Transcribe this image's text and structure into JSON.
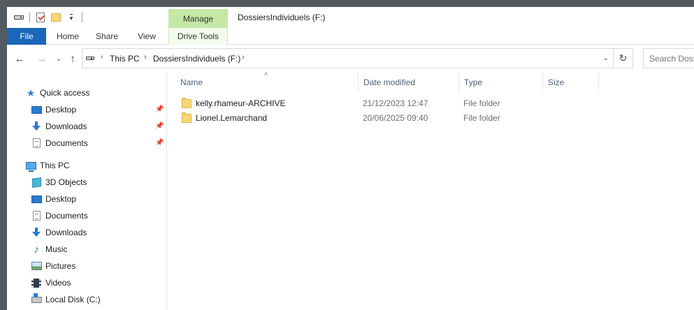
{
  "title_bar": {
    "manage_tab": "Manage",
    "window_title": "DossiersIndividuels (F:)"
  },
  "ribbon": {
    "tabs": [
      "File",
      "Home",
      "Share",
      "View",
      "Drive Tools"
    ]
  },
  "address": {
    "crumbs": [
      "This PC",
      "DossiersIndividuels (F:)"
    ],
    "search_placeholder": "Search Dossiers"
  },
  "nav_pane": {
    "quick_access": "Quick access",
    "quick_items": [
      "Desktop",
      "Downloads",
      "Documents"
    ],
    "this_pc": "This PC",
    "pc_items": [
      "3D Objects",
      "Desktop",
      "Documents",
      "Downloads",
      "Music",
      "Pictures",
      "Videos",
      "Local Disk (C:)"
    ]
  },
  "file_list": {
    "columns": [
      "Name",
      "Date modified",
      "Type",
      "Size"
    ],
    "rows": [
      {
        "name": "kelly.rhameur-ARCHIVE",
        "date": "21/12/2023 12:47",
        "type": "File folder",
        "size": ""
      },
      {
        "name": "Lionel.Lemarchand",
        "date": "20/06/2025 09:40",
        "type": "File folder",
        "size": ""
      }
    ]
  },
  "colors": {
    "file_tab": "#1a66b8",
    "manage_tab": "#c5e8a4",
    "accent_blue": "#2a7ad3",
    "folder_yellow": "#f7d774"
  }
}
